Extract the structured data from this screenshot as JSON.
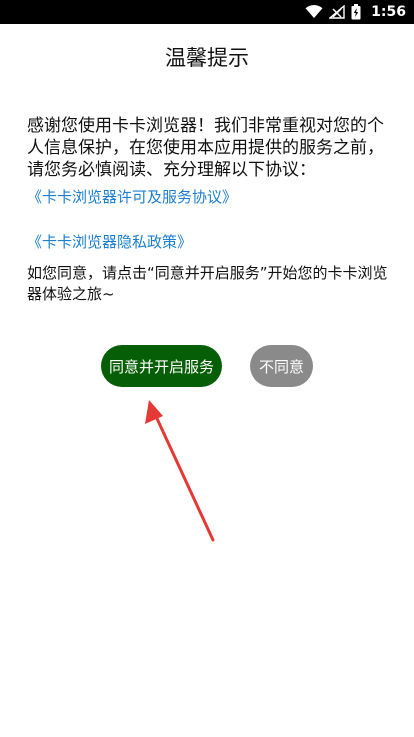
{
  "status_bar": {
    "time": "1:56",
    "icons": [
      "wifi-icon",
      "signal-muted-icon",
      "battery-charging-icon"
    ]
  },
  "dialog": {
    "title": "温馨提示",
    "intro": "感谢您使用卡卡浏览器！我们非常重视对您的个人信息保护，在您使用本应用提供的服务之前，请您务必慎阅读、充分理解以下协议：",
    "links": [
      "《卡卡浏览器许可及服务协议》",
      "《卡卡浏览器隐私政策》"
    ],
    "consent": "如您同意，请点击“同意并开启服务”开始您的卡卡浏览器体验之旅~",
    "agree_label": "同意并开启服务",
    "disagree_label": "不同意"
  },
  "colors": {
    "agree_button": "#065f06",
    "disagree_button": "#8a8a8a",
    "link": "#1a7fd0",
    "annotation_arrow": "#e53935"
  }
}
